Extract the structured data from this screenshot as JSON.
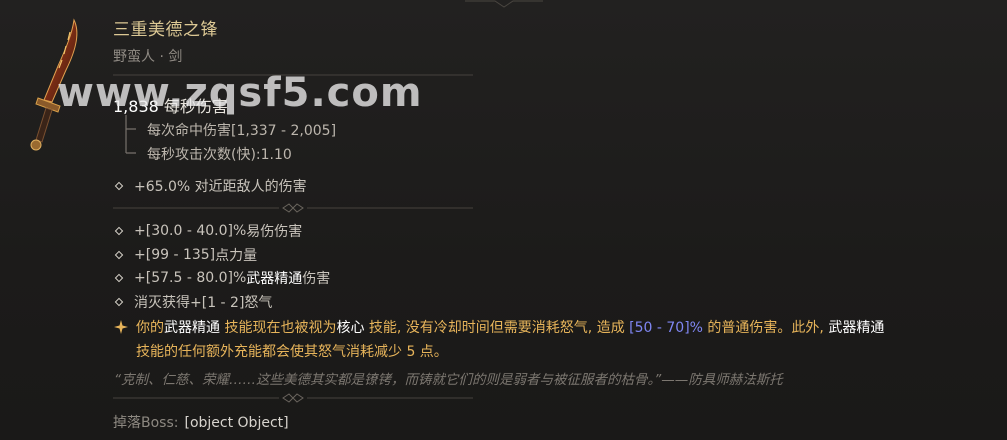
{
  "item": {
    "name": "三重美德之锋",
    "type": "野蛮人 · 剑"
  },
  "damage": {
    "dps_value": "1,838",
    "dps_label": "每秒伤害",
    "hit_damage": "每次命中伤害[1,337 - 2,005]",
    "attack_speed": "每秒攻击次数(快):1.10"
  },
  "implicit": {
    "text": "+65.0% 对近距敌人的伤害"
  },
  "affixes": [
    {
      "prefix": "+[30.0 - 40.0]% ",
      "highlight": "",
      "suffix": "易伤伤害"
    },
    {
      "prefix": "+[99 - 135] ",
      "highlight": "",
      "suffix": "点力量"
    },
    {
      "prefix": "+[57.5 - 80.0]% ",
      "highlight": "武器精通",
      "suffix": " 伤害"
    },
    {
      "prefix": "消灭获得+[1 - 2] ",
      "highlight": "",
      "suffix": "怒气"
    }
  ],
  "legendary": {
    "part1": "你的",
    "hl1": "武器精通",
    "part2": " 技能现在也被视为",
    "hl2": "核心",
    "part3": " 技能, 没有冷却时间但需要消耗怒气, 造成 ",
    "range": "[50 - 70]%",
    "part4": " 的普通伤害。此外, ",
    "hl3": "武器精通",
    "part5": "技能的任何额外充能都会使其怒气消耗减少 5 点。"
  },
  "flavor": {
    "text": "“克制、仁慈、荣耀……这些美德其实都是镣铐，而铸就它们的则是弱者与被征服者的枯骨。”——防具师赫法斯托"
  },
  "drop": {
    "label": "掉落Boss:",
    "value": "[object Object]"
  },
  "watermark": {
    "text": "www.zqsf5.com"
  },
  "colors": {
    "title": "#dcc894",
    "legendary": "#e7b45a",
    "range_blue": "#7f86f2",
    "background": "#1d1c1b"
  },
  "icons": {
    "weapon": "sword-icon",
    "bullet": "diamond-bullet-icon",
    "legendary": "legendary-star-icon"
  }
}
